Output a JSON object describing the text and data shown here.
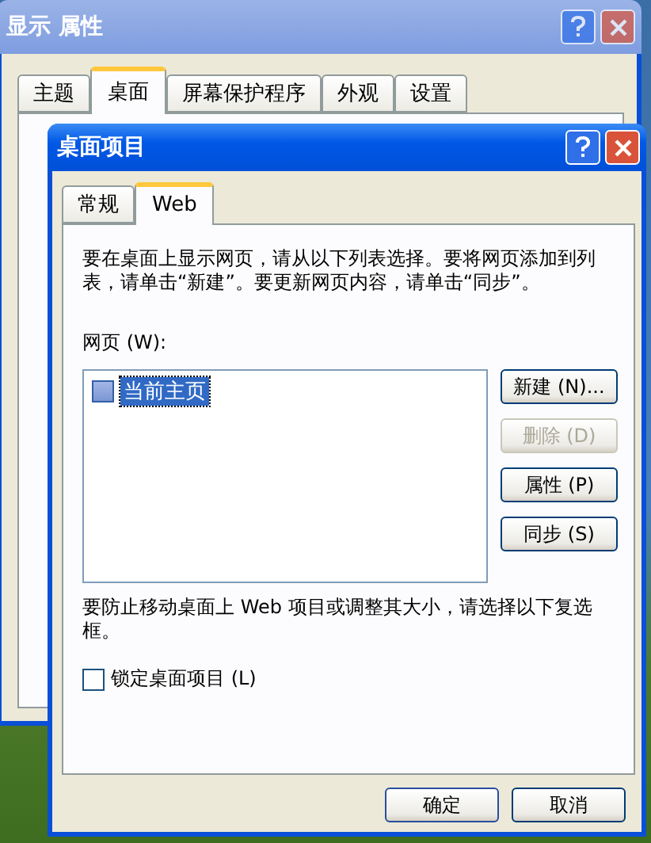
{
  "outer_window": {
    "title": "显示 属性",
    "tabs": [
      {
        "label": "主题",
        "selected": false
      },
      {
        "label": "桌面",
        "selected": true
      },
      {
        "label": "屏幕保护程序",
        "selected": false
      },
      {
        "label": "外观",
        "selected": false
      },
      {
        "label": "设置",
        "selected": false
      }
    ]
  },
  "dialog": {
    "title": "桌面项目",
    "tabs": [
      {
        "label": "常规",
        "selected": false
      },
      {
        "label": "Web",
        "selected": true
      }
    ],
    "intro": "要在桌面上显示网页，请从以下列表选择。要将网页添加到列表，请单击“新建”。要更新网页内容，请单击“同步”。",
    "list_label": "网页 (W):",
    "pages": [
      {
        "label": "当前主页",
        "checked": false,
        "selected": true
      }
    ],
    "side_buttons": [
      {
        "label": "新建 (N)...",
        "disabled": false
      },
      {
        "label": "删除 (D)",
        "disabled": true
      },
      {
        "label": "属性 (P)",
        "disabled": false
      },
      {
        "label": "同步 (S)",
        "disabled": false
      }
    ],
    "lock_note": "要防止移动桌面上 Web 项目或调整其大小，请选择以下复选框。",
    "lock": {
      "label": "锁定桌面项目 (L)",
      "checked": false
    },
    "buttons": [
      "确定",
      "取消"
    ]
  }
}
